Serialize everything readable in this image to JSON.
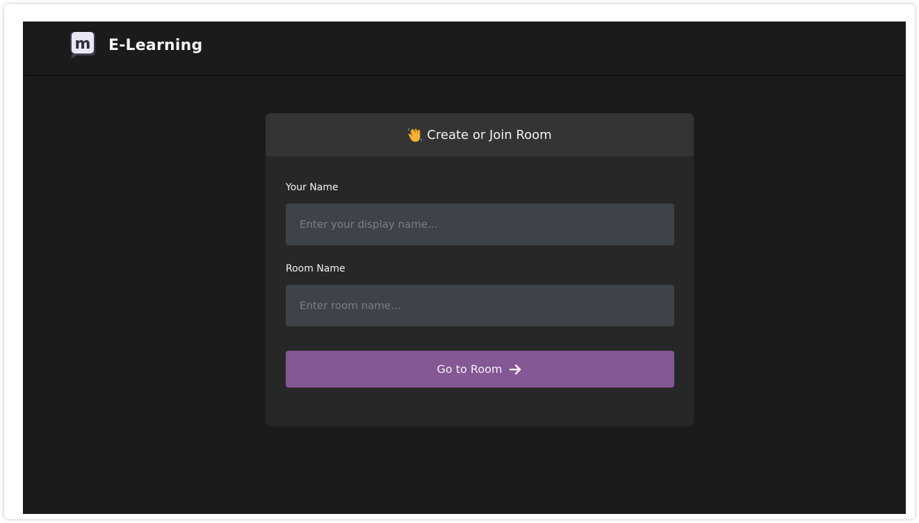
{
  "header": {
    "brand_name": "E-Learning",
    "logo_letter": "m"
  },
  "card": {
    "title": "Create or Join Room",
    "title_icon": "waving-hand-icon"
  },
  "form": {
    "name_label": "Your Name",
    "name_placeholder": "Enter your display name...",
    "room_label": "Room Name",
    "room_placeholder": "Enter room name...",
    "submit_label": "Go to Room",
    "submit_icon": "arrow-right-icon"
  },
  "colors": {
    "background": "#1b1b1b",
    "card": "#272727",
    "card_header": "#343434",
    "input": "#3e434a",
    "accent": "#845795"
  }
}
